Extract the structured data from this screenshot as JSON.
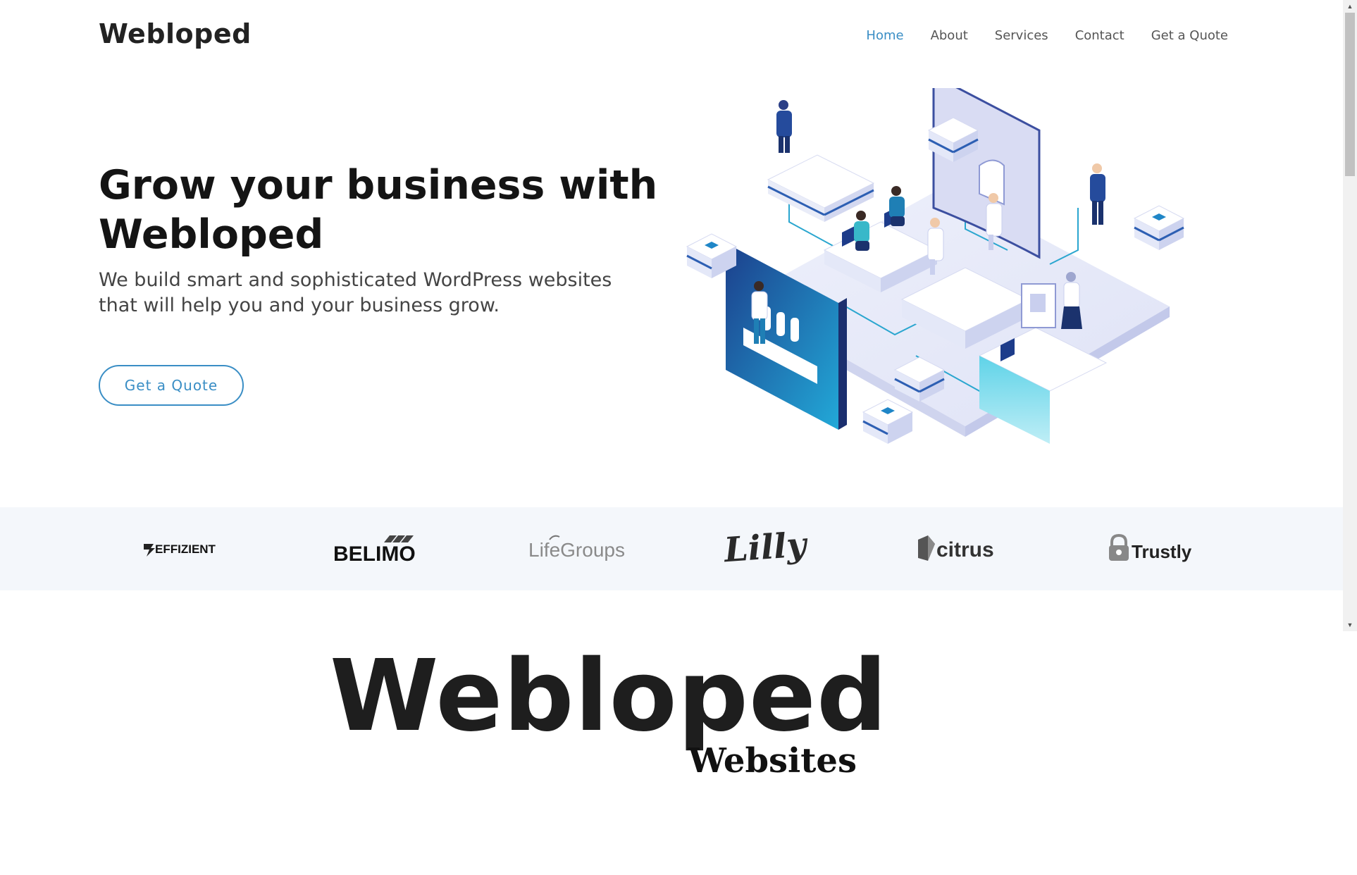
{
  "header": {
    "logo": "Webloped",
    "nav": [
      "Home",
      "About",
      "Services",
      "Contact",
      "Get a Quote"
    ],
    "active_nav": "Home"
  },
  "hero": {
    "title_line1": "Grow your business with",
    "title_line2": "Webloped",
    "subtitle_line1": "We build smart and sophisticated WordPress websites",
    "subtitle_line2": "that will help you and your business grow.",
    "cta_label": "Get a Quote",
    "illustration": "isometric-office-illustration"
  },
  "clients": {
    "logos": [
      "EFFIZIENT",
      "BELIMO",
      "LifeGroups",
      "Lilly",
      "citrus",
      "Trustly"
    ]
  },
  "footer_brand": {
    "title": "Webloped",
    "subtitle": "Websites"
  },
  "colors": {
    "accent": "#3a8ec5",
    "text_dark": "#141414",
    "clients_bg": "#f4f7fb"
  }
}
